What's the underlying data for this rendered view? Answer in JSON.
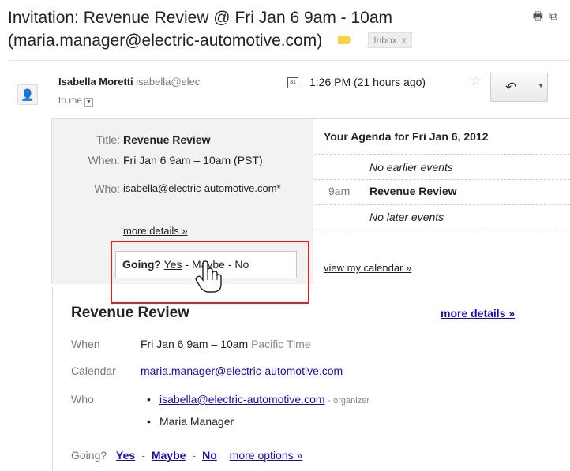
{
  "header": {
    "subject_line1": "Invitation: Revenue Review @ Fri Jan 6 9am - 10am",
    "subject_line2": "(maria.manager@electric-automotive.com)",
    "inbox_label": "Inbox",
    "inbox_remove": "x",
    "label_color": "#f5d24a"
  },
  "message": {
    "sender_name": "Isabella Moretti",
    "sender_email": "isabella@elec",
    "to": "to me",
    "calendar_icon_text": "31",
    "time": "1:26 PM (21 hours ago)"
  },
  "invite": {
    "title_label": "Title:",
    "title_value": "Revenue Review",
    "when_label": "When:",
    "when_value": "Fri Jan 6 9am – 10am (PST)",
    "who_label": "Who:",
    "who_value": "isabella@electric-automotive.com*",
    "more_details": "more details »",
    "going_label": "Going?",
    "yes": "Yes",
    "maybe": "Maybe",
    "no": "No",
    "sep": "-"
  },
  "agenda": {
    "title": "Your Agenda for Fri Jan 6, 2012",
    "no_earlier": "No earlier events",
    "event_time": "9am",
    "event_name": "Revenue Review",
    "no_later": "No later events",
    "view_calendar": "view my calendar »"
  },
  "details": {
    "title": "Revenue Review",
    "more_details": "more details »",
    "when_label": "When",
    "when_value": "Fri Jan 6 9am – 10am",
    "when_tz": "Pacific Time",
    "calendar_label": "Calendar",
    "calendar_value": "maria.manager@electric-automotive.com",
    "who_label": "Who",
    "who_1": "isabella@electric-automotive.com",
    "who_1_role": "- organizer",
    "who_2": "Maria Manager",
    "bullet": "•",
    "going_label": "Going?",
    "yes": "Yes",
    "maybe": "Maybe",
    "no": "No",
    "more_options": "more options »"
  },
  "colors": {
    "highlight_frame": "#e0202a",
    "link": "#1a0dab"
  }
}
